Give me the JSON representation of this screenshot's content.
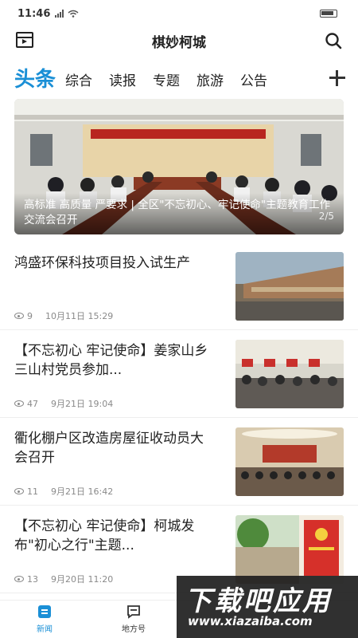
{
  "status": {
    "time": "11:46",
    "signal_text": "⁵ᴳ ᵢₗ"
  },
  "header": {
    "title": "棋妙柯城",
    "left_icon": "video-icon",
    "right_icon": "search-icon"
  },
  "tabs": {
    "active": "头条",
    "items": [
      "综合",
      "读报",
      "专题",
      "旅游",
      "公告"
    ],
    "add_icon": "plus-icon"
  },
  "banner": {
    "caption": "高标准 高质量 严要求 | 全区\"不忘初心、牢记使命\"主题教育工作交流会召开",
    "pager": "2/5"
  },
  "news": [
    {
      "title": "鸿盛环保科技项目投入试生产",
      "views": "9",
      "date": "10月11日 15:29"
    },
    {
      "title": "【不忘初心 牢记使命】姜家山乡三山村党员参加...",
      "views": "47",
      "date": "9月21日 19:04"
    },
    {
      "title": "衢化棚户区改造房屋征收动员大会召开",
      "views": "11",
      "date": "9月21日 16:42"
    },
    {
      "title": "【不忘初心 牢记使命】柯城发布\"初心之行\"主题...",
      "views": "13",
      "date": "9月20日 11:20"
    }
  ],
  "bottom_nav": [
    {
      "label": "新闻",
      "icon": "news-icon"
    },
    {
      "label": "地方号",
      "icon": "chat-icon"
    }
  ],
  "watermark": {
    "big": "下载吧应用",
    "small": "www.xiazaiba.com"
  },
  "colors": {
    "accent": "#1a8fd6"
  }
}
